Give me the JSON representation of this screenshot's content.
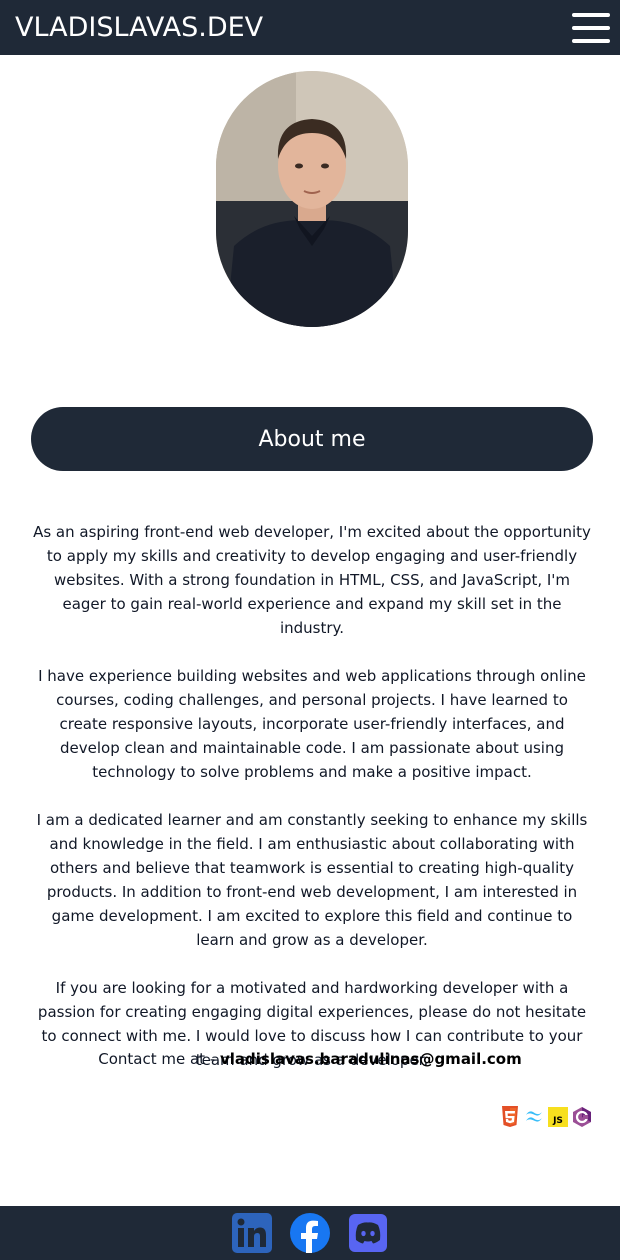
{
  "header": {
    "brand": "VLADISLAVAS.DEV",
    "menu_icon": "hamburger-menu-icon"
  },
  "profile": {
    "photo": "profile-photo"
  },
  "about": {
    "heading": "About me",
    "paragraphs": [
      "As an aspiring front-end web developer, I'm excited about the opportunity to apply my skills and creativity to develop engaging and user-friendly websites. With a strong foundation in HTML, CSS, and JavaScript, I'm eager to gain real-world experience and expand my skill set in the industry.",
      "I have experience building websites and web applications through online courses, coding challenges, and personal projects. I have learned to create responsive layouts, incorporate user-friendly interfaces, and develop clean and maintainable code. I am passionate about using technology to solve problems and make a positive impact.",
      "I am a dedicated learner and am constantly seeking to enhance my skills and knowledge in the field. I am enthusiastic about collaborating with others and believe that teamwork is essential to creating high-quality products. In addition to front-end web development, I am interested in game development. I am excited to explore this field and continue to learn and grow as a developer.",
      "If you are looking for a motivated and hardworking developer with a passion for creating engaging digital experiences, please do not hesitate to connect with me. I would love to discuss how I can contribute to your team and grow as a developer."
    ],
    "contact_prefix": "Contact me at - ",
    "contact_email": "vladislavas.baradulinas@gmail.com"
  },
  "tech_icons": [
    "html5-icon",
    "tailwind-icon",
    "javascript-icon",
    "csharp-icon"
  ],
  "footer": {
    "social_icons": [
      "linkedin-icon",
      "facebook-icon",
      "discord-icon"
    ]
  },
  "colors": {
    "dark": "#1f2937",
    "linkedin": "#2d64bc",
    "facebook": "#1877f2",
    "discord": "#5865f2"
  }
}
